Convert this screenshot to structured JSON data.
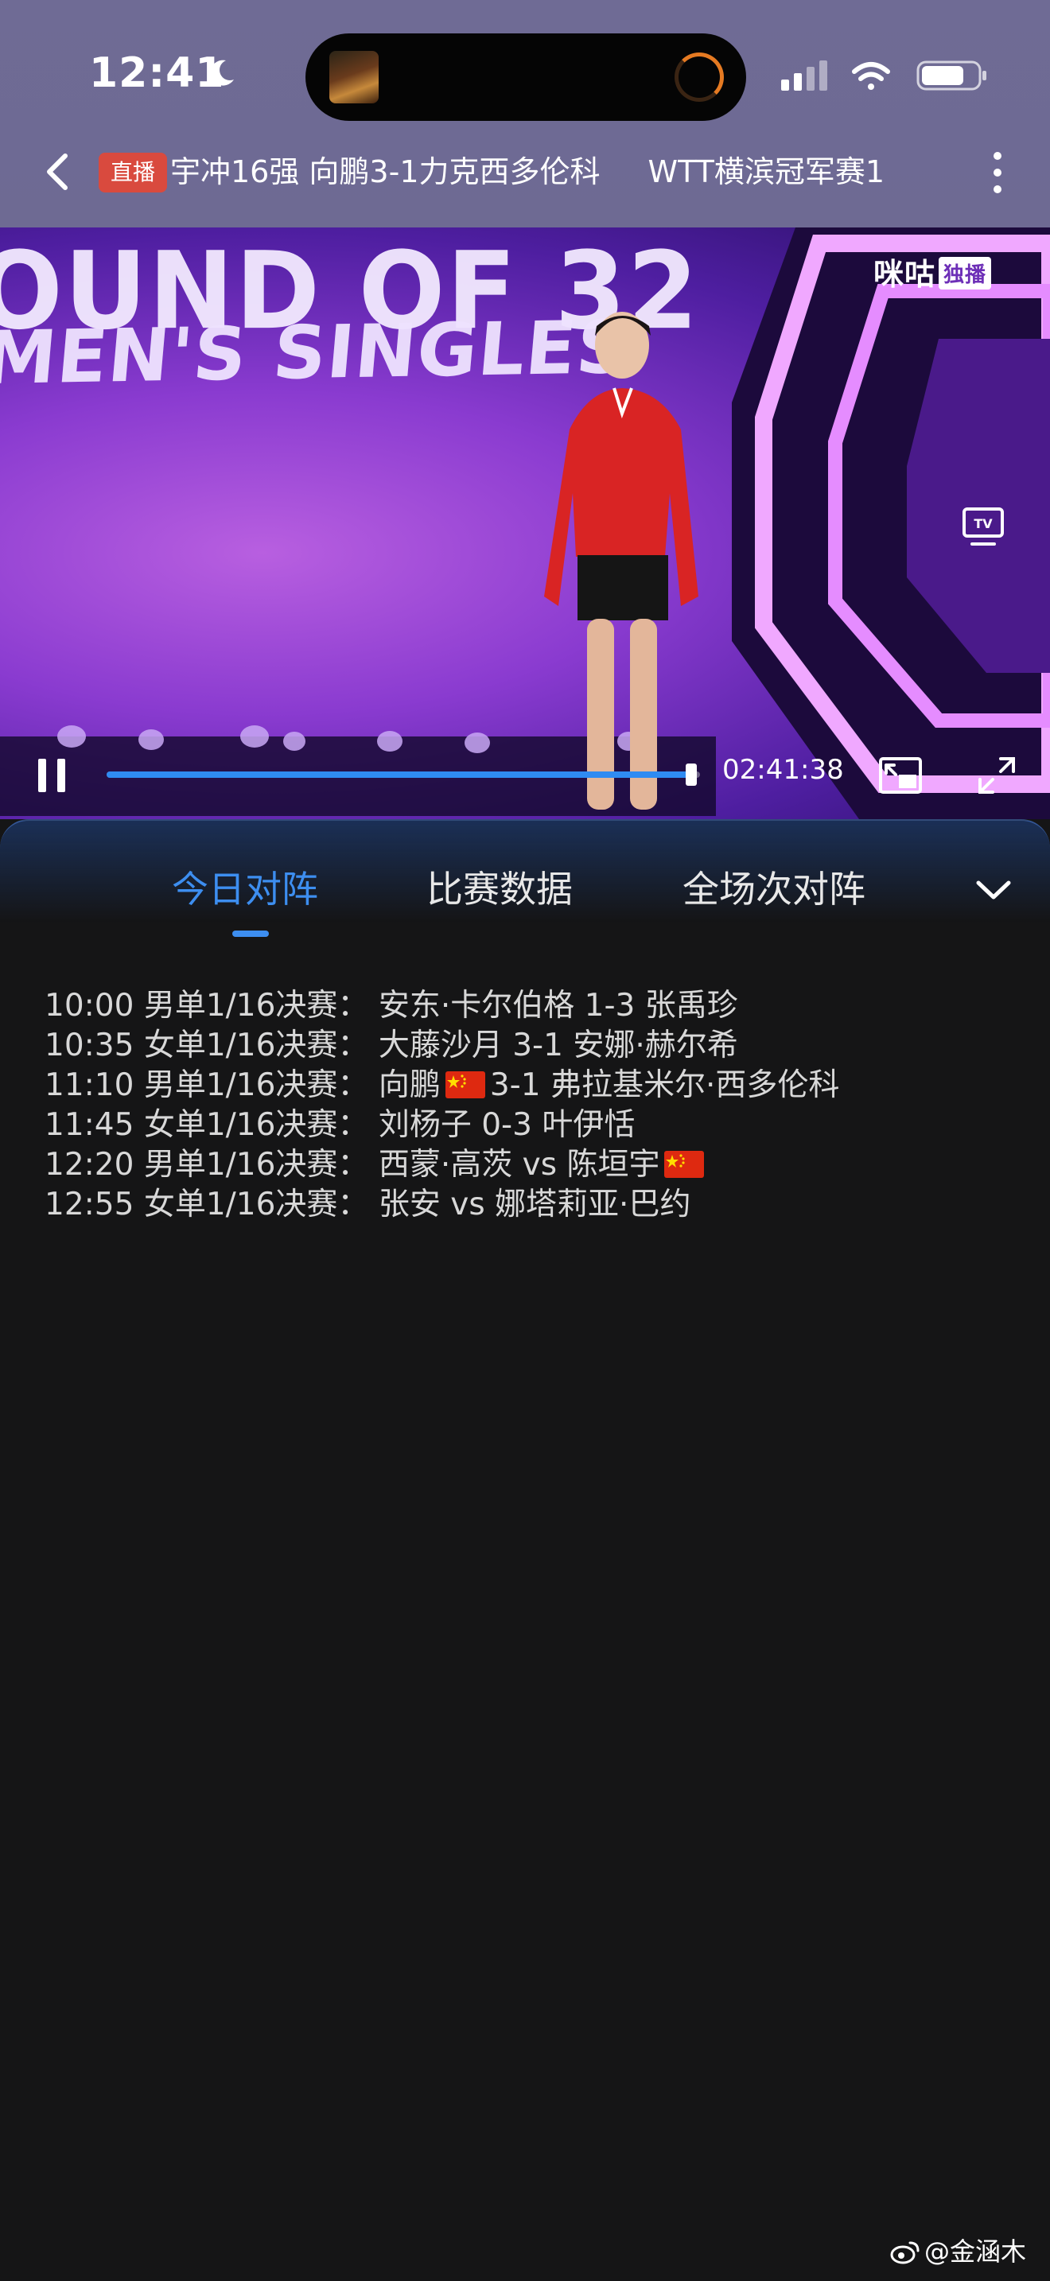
{
  "status_bar": {
    "time": "12:41",
    "icons": [
      "moon-icon",
      "cellular-signal-icon",
      "wifi-icon",
      "battery-icon"
    ]
  },
  "dynamic_island": {
    "icons": [
      "media-thumbnail",
      "progress-ring-icon"
    ]
  },
  "title_bar": {
    "live_badge": "直播",
    "marquee_segments": [
      "宇冲16强 向鹏3-1力克西多伦科",
      "WTT横滨冠军赛1"
    ],
    "icons": [
      "back-chevron-icon",
      "more-vertical-icon"
    ]
  },
  "video": {
    "overlay_text_line_1": "OUND OF 32",
    "overlay_text_line_2": "MEN'S SINGLES",
    "watermark": "咪咕",
    "watermark_tag": "独播",
    "elapsed_time": "02:41:38",
    "progress_fraction": 0.985,
    "icons": [
      "tv-cast-icon",
      "pause-icon",
      "picture-in-picture-icon",
      "fullscreen-icon"
    ]
  },
  "tabs": {
    "items": [
      {
        "label": "今日对阵",
        "active": true
      },
      {
        "label": "比赛数据",
        "active": false
      },
      {
        "label": "全场次对阵",
        "active": false
      }
    ],
    "accent_color": "#3d8ef0",
    "icons": [
      "collapse-chevron-icon"
    ]
  },
  "schedule": {
    "matches": [
      {
        "time": "10:00",
        "event": "男单1/16决赛：",
        "player1": "安东·卡尔伯格",
        "player1_flag": "",
        "score": "1-3",
        "player2": "张禹珍",
        "player2_flag": ""
      },
      {
        "time": "10:35",
        "event": "女单1/16决赛：",
        "player1": "大藤沙月",
        "player1_flag": "",
        "score": "3-1",
        "player2": "安娜·赫尔希",
        "player2_flag": ""
      },
      {
        "time": "11:10",
        "event": "男单1/16决赛：",
        "player1": "向鹏",
        "player1_flag": "china-flag-icon",
        "score": "3-1",
        "player2": "弗拉基米尔·西多伦科",
        "player2_flag": ""
      },
      {
        "time": "11:45",
        "event": "女单1/16决赛：",
        "player1": "刘杨子",
        "player1_flag": "",
        "score": "0-3",
        "player2": "叶伊恬",
        "player2_flag": ""
      },
      {
        "time": "12:20",
        "event": "男单1/16决赛：",
        "player1": "西蒙·高茨",
        "player1_flag": "",
        "score": "vs",
        "player2": "陈垣宇",
        "player2_flag": "china-flag-icon"
      },
      {
        "time": "12:55",
        "event": "女单1/16决赛：",
        "player1": "张安",
        "player1_flag": "",
        "score": "vs",
        "player2": "娜塔莉亚·巴约",
        "player2_flag": ""
      }
    ]
  },
  "credit": {
    "text": "@金涵木",
    "icon": "weibo-icon"
  }
}
